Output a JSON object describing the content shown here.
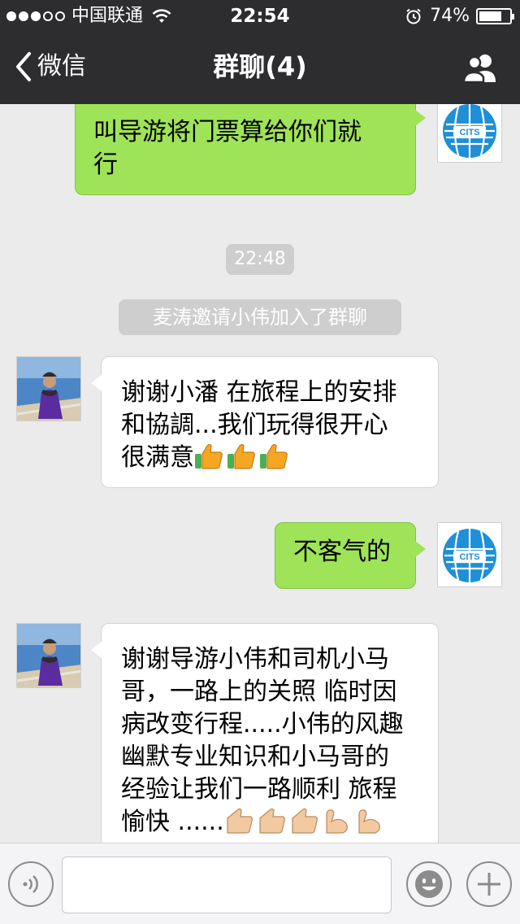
{
  "status_bar": {
    "carrier": "中国联通",
    "time": "22:54",
    "battery_percent": "74%",
    "battery_level": 0.74,
    "signal_bars_filled": 3,
    "signal_bars_total": 5
  },
  "nav": {
    "back_label": "微信",
    "title": "群聊(4)",
    "right_icon": "people-icon"
  },
  "messages": [
    {
      "side": "out",
      "text_lines": [
        "叫导游将门票算给你们就",
        "行"
      ]
    },
    {
      "type": "time",
      "text": "22:48"
    },
    {
      "type": "system",
      "text": "麦涛邀请小伟加入了群聊"
    },
    {
      "side": "in",
      "text_lines": [
        "谢谢小潘 在旅程上的安排",
        "和協調...我们玩得很开心",
        "很满意"
      ],
      "emoji_tail": [
        "thumbs-up",
        "thumbs-up",
        "thumbs-up"
      ]
    },
    {
      "side": "out",
      "text_lines": [
        "不客气的"
      ]
    },
    {
      "side": "in",
      "text_lines": [
        "谢谢导游小伟和司机小马",
        "哥，一路上的关照 临时因",
        "病改变行程.....小伟的风趣",
        "幽默专业知识和小马哥的",
        "经验让我们一路顺利 旅程",
        "愉快 ......"
      ],
      "emoji_tail": [
        "thumbs-up-light",
        "thumbs-up-light",
        "thumbs-up-light",
        "flexed-biceps",
        "flexed-biceps"
      ]
    }
  ],
  "avatar_logo_text": "CITS",
  "avatar_logo_top_text": "中国国旅",
  "input_bar": {
    "voice_icon": "voice-icon",
    "emoji_icon": "smiley-icon",
    "plus_icon": "plus-icon",
    "placeholder": ""
  },
  "colors": {
    "bar_bg": "#2d2d2f",
    "chat_bg": "#ebebeb",
    "outgoing_bubble": "#9fe358",
    "incoming_bubble": "#ffffff",
    "pill_bg": "#cecece"
  }
}
